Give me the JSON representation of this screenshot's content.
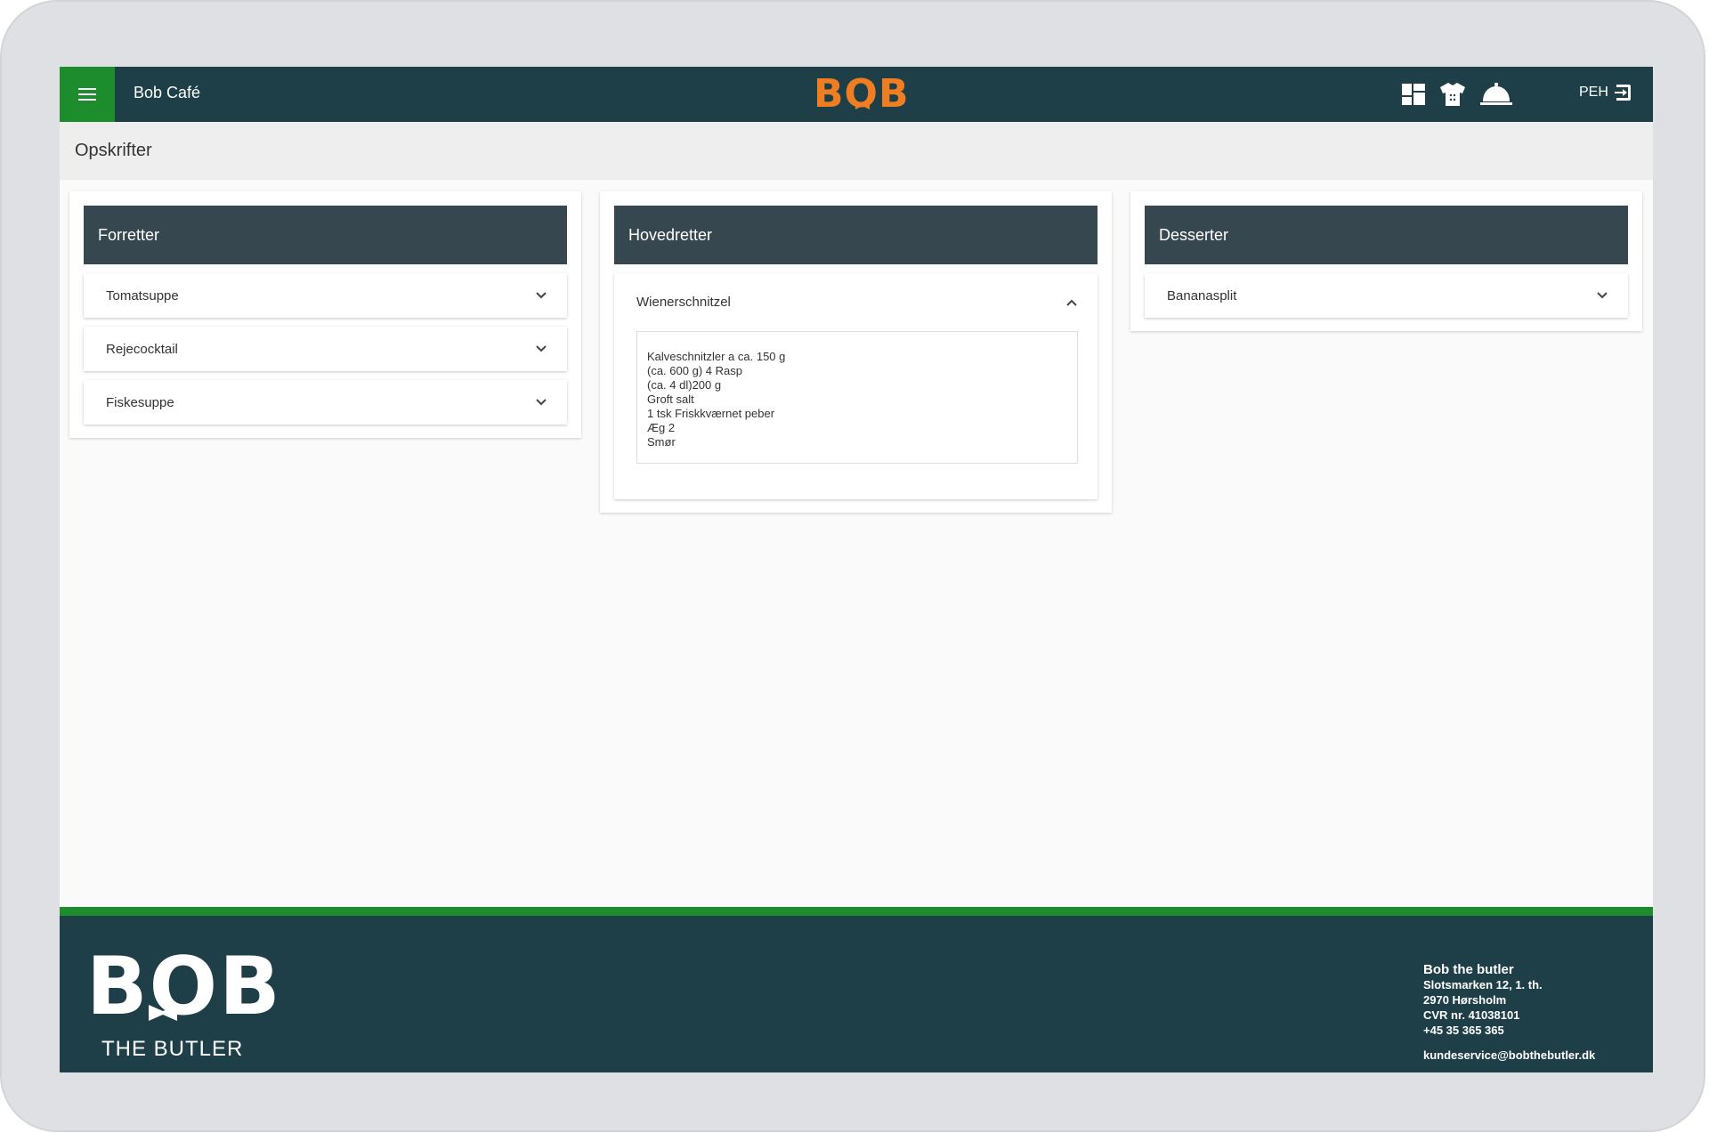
{
  "header": {
    "app_title": "Bob Café",
    "logo_text": "BOB",
    "user_initials": "PEH",
    "icons": [
      "menu-icon",
      "dashboard-icon",
      "chef-jacket-icon",
      "cloche-icon",
      "logout-icon"
    ]
  },
  "page": {
    "title": "Opskrifter"
  },
  "columns": [
    {
      "title": "Forretter",
      "items": [
        {
          "label": "Tomatsuppe"
        },
        {
          "label": "Rejecocktail"
        },
        {
          "label": "Fiskesuppe"
        }
      ]
    },
    {
      "title": "Hovedretter",
      "items": [
        {
          "label": "Wienerschnitzel",
          "lines": [
            "Kalveschnitzler a ca. 150 g",
            "(ca. 600 g) 4 Rasp",
            "(ca. 4 dl)200 g",
            "Groft salt",
            "1 tsk Friskkværnet peber",
            "Æg 2",
            "Smør"
          ]
        }
      ]
    },
    {
      "title": "Desserter",
      "items": [
        {
          "label": "Bananasplit"
        }
      ]
    }
  ],
  "footer": {
    "logo_text": "BOB",
    "logo_subtitle": "THE BUTLER",
    "company": "Bob the butler",
    "address1": "Slotsmarken 12, 1. th.",
    "address2": "2970 Hørsholm",
    "cvr": "CVR nr. 41038101",
    "phone": "+45 35 365 365",
    "email": "kundeservice@bobthebutler.dk"
  },
  "colors": {
    "topbar": "#1e3f48",
    "accent_green": "#1d8c2d",
    "logo_orange": "#ef7d22",
    "column_header": "#37474f"
  }
}
